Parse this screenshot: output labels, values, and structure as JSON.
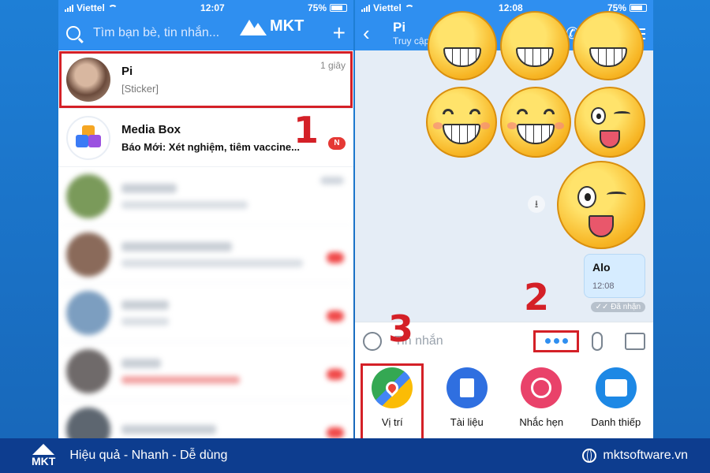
{
  "left": {
    "status": {
      "carrier": "Viettel",
      "time": "12:07",
      "battery": "75%"
    },
    "search": {
      "placeholder": "Tìm bạn bè, tin nhắn..."
    },
    "brand": {
      "logo_text": "MKT"
    },
    "conversations": [
      {
        "name": "Pi",
        "preview": "[Sticker]",
        "time": "1 giây",
        "highlight": true
      },
      {
        "name": "Media Box",
        "preview": "Báo Mới: Xét nghiệm, tiêm vaccine...",
        "badge": "N"
      }
    ],
    "step_1": "1"
  },
  "right": {
    "status": {
      "carrier": "Viettel",
      "time": "12:08",
      "battery": "75%"
    },
    "chat": {
      "name": "Pi",
      "last_seen": "Truy cập 48 phút trước"
    },
    "message": {
      "text": "Alo",
      "time": "12:08",
      "status": "✓✓ Đã nhận"
    },
    "composer": {
      "placeholder": "Tin nhắn"
    },
    "tools": [
      {
        "label": "Vị trí",
        "icon": "map-location-icon"
      },
      {
        "label": "Tài liệu",
        "icon": "document-icon"
      },
      {
        "label": "Nhắc hẹn",
        "icon": "alarm-clock-icon"
      },
      {
        "label": "Danh thiếp",
        "icon": "business-card-icon"
      }
    ],
    "step_2": "2",
    "step_3": "3"
  },
  "footer": {
    "logo": "MKT",
    "slogan": "Hiệu quả - Nhanh - Dễ dùng",
    "website": "mktsoftware.vn"
  },
  "colors": {
    "zalo_blue": "#2f8ff0",
    "annotation_red": "#d42027",
    "footer_navy": "#0d3d8f"
  }
}
